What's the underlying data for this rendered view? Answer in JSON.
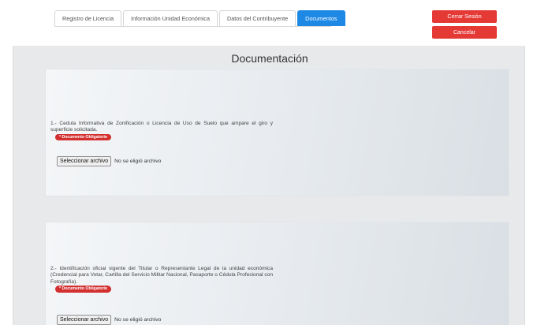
{
  "tabs": [
    {
      "label": "Registro de Licencia",
      "active": false
    },
    {
      "label": "Información Unidad Económica",
      "active": false
    },
    {
      "label": "Datos del Contribuyente",
      "active": false
    },
    {
      "label": "Documentos",
      "active": true
    }
  ],
  "header": {
    "logout_label": "Cerrar Sesión",
    "cancel_label": "Cancelar"
  },
  "page_title": "Documentación",
  "documents": [
    {
      "text": "1.- Cedula Informativa de Zonificación o Licencia de Uso de Suelo que ampare el giro y superficie solicitada.",
      "badge": "* Documento Obligatorio",
      "file_button": "Seleccionar archivo",
      "file_status": "No se eligió archivo"
    },
    {
      "text": "2.- Identificación oficial vigente del Titular o Representante Legal de la unidad económica (Credencial para Votar, Cartilla del Servicio Militar Nacional, Pasaporte o Cédula Profesional con Fotografía).",
      "badge": "* Documento Obligatorio",
      "file_button": "Seleccionar archivo",
      "file_status": "No se eligió archivo"
    }
  ],
  "colors": {
    "accent": "#1e88e5",
    "danger": "#e53935",
    "badge": "#d32f2f",
    "background": "#e8e9eb"
  }
}
